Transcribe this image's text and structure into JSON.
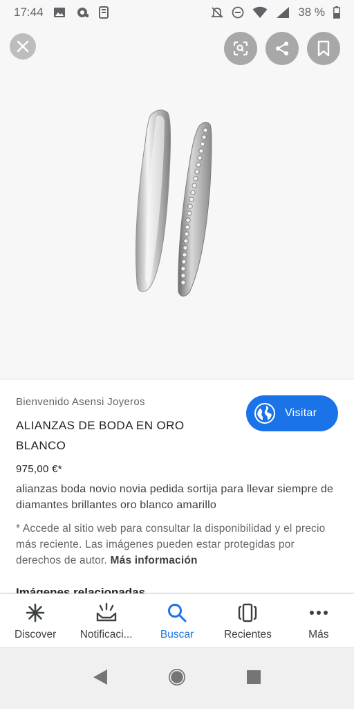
{
  "status_bar": {
    "time": "17:44",
    "battery": "38 %"
  },
  "viewer": {
    "actions": [
      "close-icon",
      "lens-icon",
      "share-icon",
      "bookmark-icon"
    ]
  },
  "result": {
    "source": "Bienvenido Asensi Joyeros",
    "title": "ALIANZAS DE BODA EN ORO BLANCO",
    "visit_label": "Visitar",
    "price": "975,00 €*",
    "description": "alianzas boda novio novia pedida sortija para llevar siempre de diamantes brillantes oro blanco amarillo",
    "disclaimer": "* Accede al sitio web para consultar la disponibilidad y el precio más reciente. Las imágenes pueden estar protegidas por derechos de autor.",
    "more_info": "Más información",
    "related_heading": "Imágenes relacionadas"
  },
  "bottom_nav": [
    {
      "label": "Discover",
      "icon": "asterisk-icon"
    },
    {
      "label": "Notificaci...",
      "icon": "notifications-icon"
    },
    {
      "label": "Buscar",
      "icon": "search-icon",
      "active": true
    },
    {
      "label": "Recientes",
      "icon": "recent-icon"
    },
    {
      "label": "Más",
      "icon": "more-icon"
    }
  ],
  "colors": {
    "accent": "#1a73e8",
    "text": "#202124",
    "muted": "#5f6368"
  }
}
